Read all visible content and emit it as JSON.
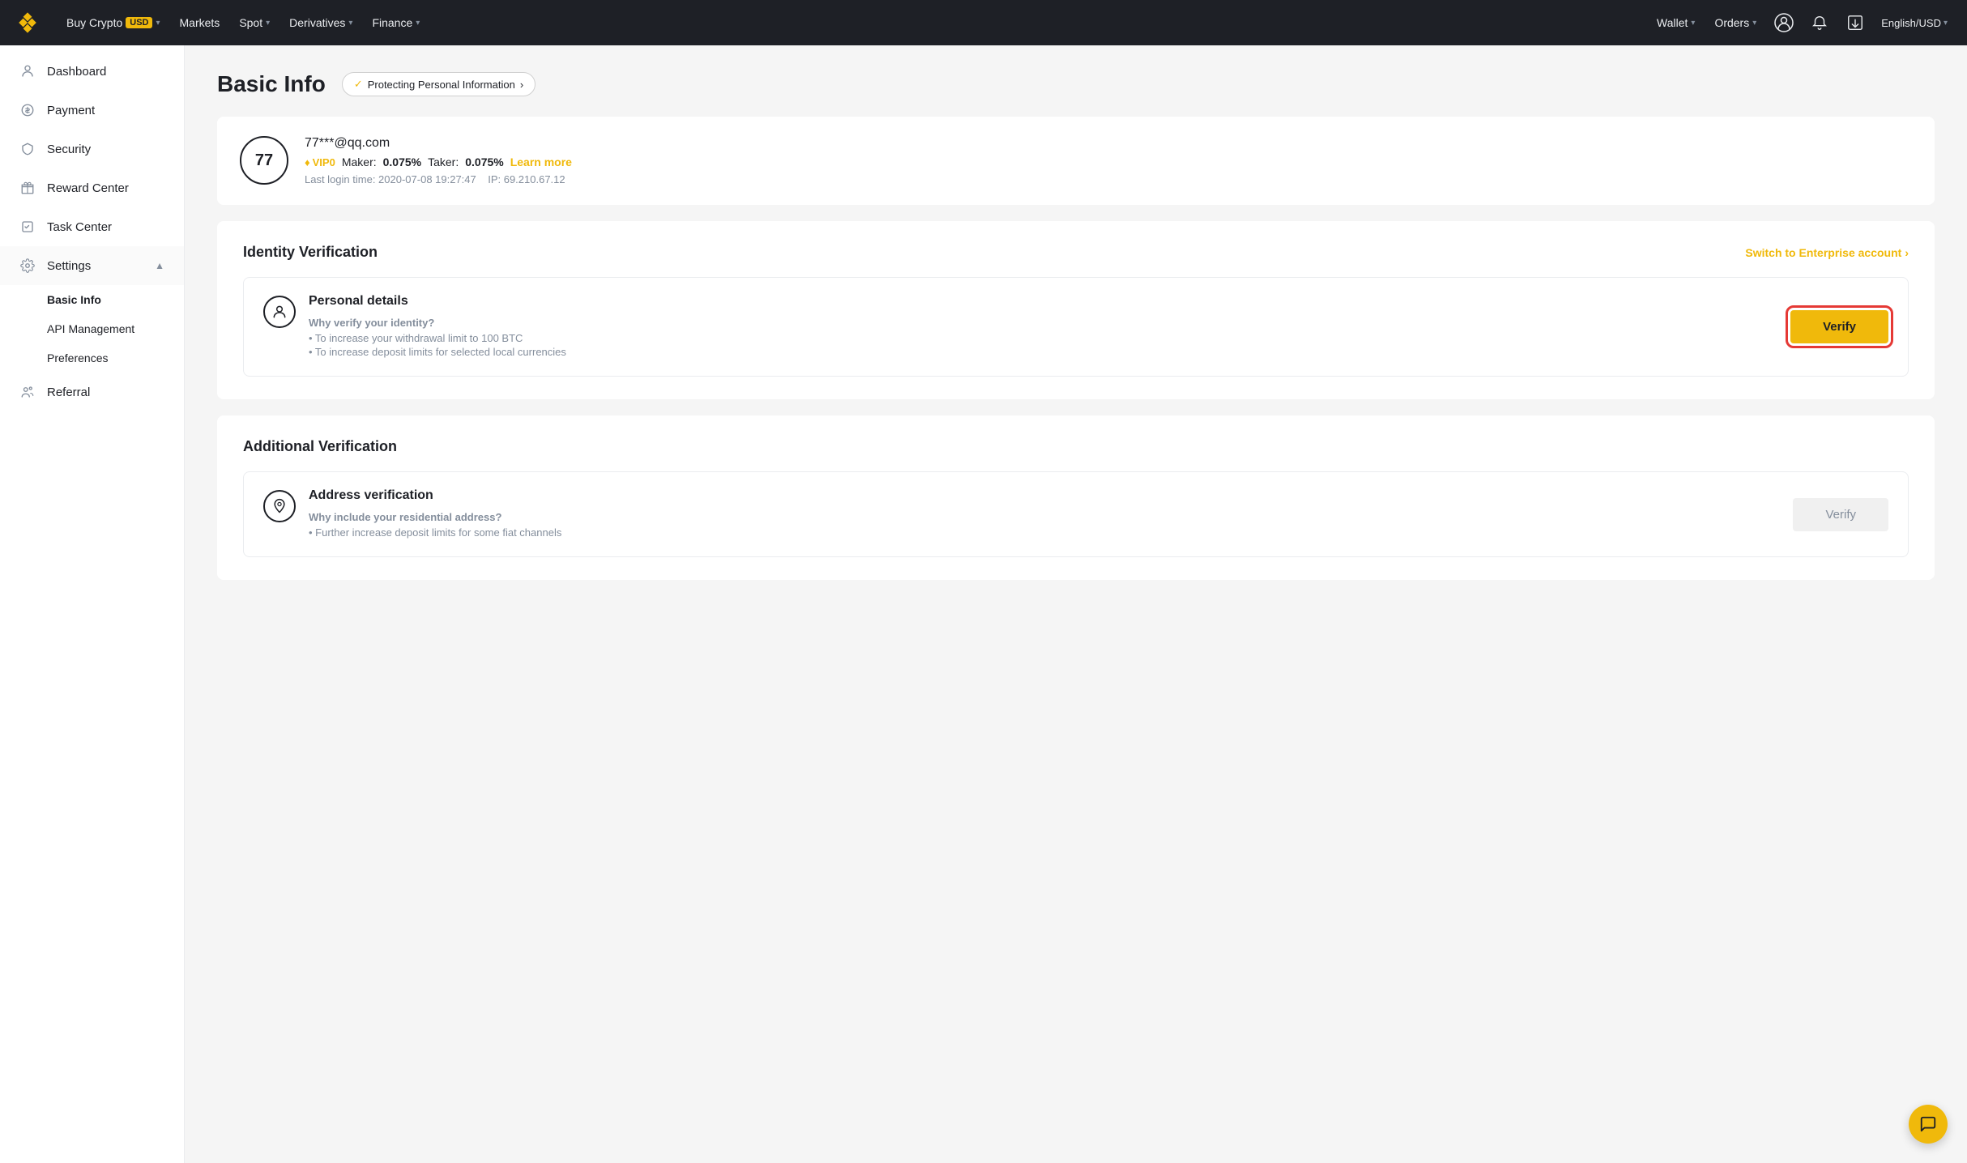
{
  "brand": {
    "name": "Binance"
  },
  "topnav": {
    "items": [
      {
        "label": "Buy Crypto",
        "badge": "USD"
      },
      {
        "label": "Markets"
      },
      {
        "label": "Spot"
      },
      {
        "label": "Derivatives"
      },
      {
        "label": "Finance"
      },
      {
        "label": "Wallet"
      },
      {
        "label": "Orders"
      }
    ],
    "lang": "English/USD"
  },
  "sidebar": {
    "items": [
      {
        "label": "Dashboard",
        "icon": "user"
      },
      {
        "label": "Payment",
        "icon": "dollar"
      },
      {
        "label": "Security",
        "icon": "shield"
      },
      {
        "label": "Reward Center",
        "icon": "gift"
      },
      {
        "label": "Task Center",
        "icon": "task"
      },
      {
        "label": "Settings",
        "icon": "settings",
        "expanded": true,
        "children": [
          {
            "label": "Basic Info",
            "active": true
          },
          {
            "label": "API Management"
          },
          {
            "label": "Preferences"
          }
        ]
      },
      {
        "label": "Referral",
        "icon": "referral"
      }
    ]
  },
  "page": {
    "title": "Basic Info",
    "privacy_badge": "Protecting Personal Information",
    "user": {
      "avatar": "77",
      "email": "77***@qq.com",
      "vip_level": "VIP0",
      "maker_label": "Maker:",
      "maker_fee": "0.075%",
      "taker_label": "Taker:",
      "taker_fee": "0.075%",
      "learn_more": "Learn more",
      "last_login": "Last login time: 2020-07-08 19:27:47",
      "ip": "IP: 69.210.67.12"
    },
    "identity_verification": {
      "title": "Identity Verification",
      "switch_enterprise": "Switch to Enterprise account",
      "personal_details": {
        "name": "Personal details",
        "why_label": "Why verify your identity?",
        "bullets": [
          "• To increase your withdrawal limit to 100 BTC",
          "• To increase deposit limits for selected local currencies"
        ],
        "button": "Verify"
      }
    },
    "additional_verification": {
      "title": "Additional Verification",
      "address_verification": {
        "name": "Address verification",
        "why_label": "Why include your residential address?",
        "bullets": [
          "• Further increase deposit limits for some fiat channels"
        ],
        "button": "Verify"
      }
    }
  }
}
